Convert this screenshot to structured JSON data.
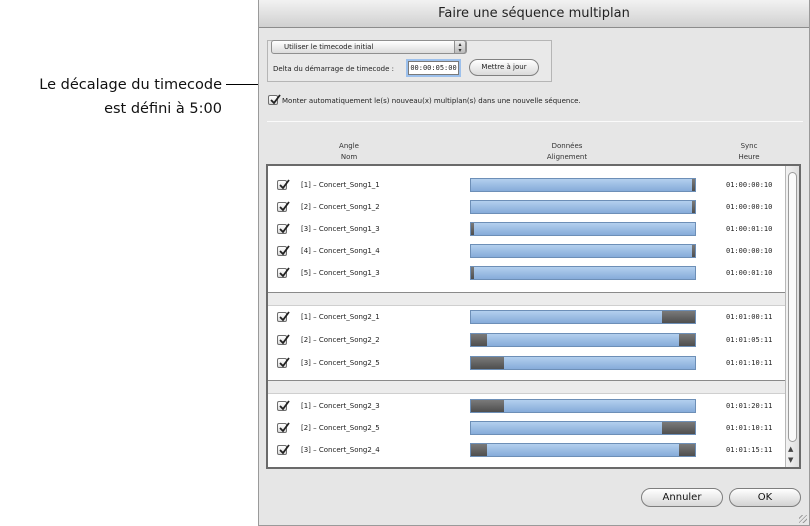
{
  "callout": {
    "line1": "Le décalage du timecode",
    "line2": "est défini à 5:00"
  },
  "dialog": {
    "title": "Faire une séquence multiplan",
    "timecode_popup": "Utiliser le timecode initial",
    "delta_label": "Delta du démarrage de timecode :",
    "delta_value": "00:00:05:00",
    "update_button": "Mettre à jour",
    "auto_open_label": "Monter automatiquement le(s) nouveau(x) multiplan(s) dans une nouvelle séquence.",
    "auto_open_checked": true,
    "columns": {
      "col1_line1": "Angle",
      "col1_line2": "Nom",
      "col2_line1": "Données",
      "col2_line2": "Alignement",
      "col3_line1": "Sync",
      "col3_line2": "Heure"
    },
    "groups": [
      {
        "rows": [
          {
            "name": "[1] – Concert_Song1_1",
            "time": "01:00:00:10",
            "checked": true
          },
          {
            "name": "[2] – Concert_Song1_2",
            "time": "01:00:00:10",
            "checked": true
          },
          {
            "name": "[3] – Concert_Song1_3",
            "time": "01:00:01:10",
            "checked": true
          },
          {
            "name": "[4] – Concert_Song1_4",
            "time": "01:00:00:10",
            "checked": true
          },
          {
            "name": "[5] – Concert_Song1_3",
            "time": "01:00:01:10",
            "checked": true
          }
        ]
      },
      {
        "rows": [
          {
            "name": "[1] – Concert_Song2_1",
            "time": "01:01:00:11",
            "checked": true
          },
          {
            "name": "[2] – Concert_Song2_2",
            "time": "01:01:05:11",
            "checked": true
          },
          {
            "name": "[3] – Concert_Song2_5",
            "time": "01:01:10:11",
            "checked": true
          }
        ]
      },
      {
        "rows": [
          {
            "name": "[1] – Concert_Song2_3",
            "time": "01:01:20:11",
            "checked": true
          },
          {
            "name": "[2] – Concert_Song2_5",
            "time": "01:01:10:11",
            "checked": true
          },
          {
            "name": "[3] – Concert_Song2_4",
            "time": "01:01:15:11",
            "checked": true
          }
        ]
      }
    ],
    "cancel_button": "Annuler",
    "ok_button": "OK"
  },
  "colors": {
    "bar_blue": "#9ebde5",
    "offset_block": "#5a5a5a",
    "focus_ring": "#9cc0ec"
  },
  "icons": {
    "popup": "up-down-arrows-icon",
    "check": "checkmark-icon",
    "resize": "resize-grip-icon"
  }
}
